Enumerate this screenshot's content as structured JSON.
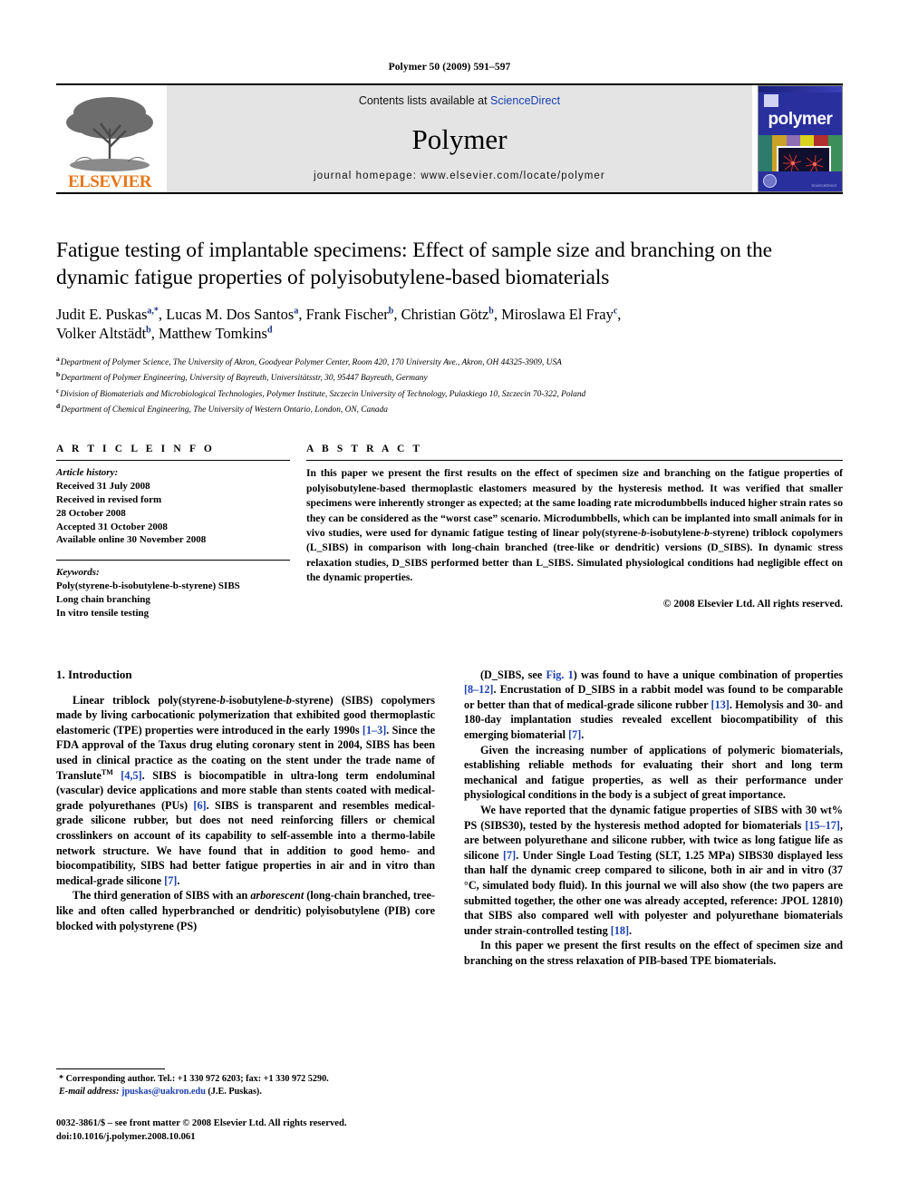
{
  "running_head": "Polymer 50 (2009) 591–597",
  "masthead": {
    "publisher_name": "ELSEVIER",
    "contents_prefix": "Contents lists available at ",
    "contents_link": "ScienceDirect",
    "journal_name": "Polymer",
    "homepage": "journal homepage: www.elsevier.com/locate/polymer",
    "cover_title": "polymer",
    "link_color": "#1a3fb0"
  },
  "article": {
    "title": "Fatigue testing of implantable specimens: Effect of sample size and branching on the dynamic fatigue properties of polyisobutylene-based biomaterials",
    "authors_line1_parts": [
      {
        "name": "Judit E. Puskas",
        "sup": "a,*"
      },
      {
        "name": "Lucas M. Dos Santos",
        "sup": "a"
      },
      {
        "name": "Frank Fischer",
        "sup": "b"
      },
      {
        "name": "Christian Götz",
        "sup": "b"
      },
      {
        "name": "Miroslawa El Fray",
        "sup": "c"
      }
    ],
    "authors_line2_parts": [
      {
        "name": "Volker Altstädt",
        "sup": "b"
      },
      {
        "name": "Matthew Tomkins",
        "sup": "d"
      }
    ],
    "affiliations": [
      {
        "mark": "a",
        "text": "Department of Polymer Science, The University of Akron, Goodyear Polymer Center, Room 420, 170 University Ave., Akron, OH 44325-3909, USA"
      },
      {
        "mark": "b",
        "text": "Department of Polymer Engineering, University of Bayreuth, Universitätsstr, 30, 95447 Bayreuth, Germany"
      },
      {
        "mark": "c",
        "text": "Division of Biomaterials and Microbiological Technologies, Polymer Institute, Szczecin University of Technology, Pulaskiego 10, Szczecin 70-322, Poland"
      },
      {
        "mark": "d",
        "text": "Department of Chemical Engineering, The University of Western Ontario, London, ON, Canada"
      }
    ]
  },
  "article_info": {
    "heading": "A R T I C L E  I N F O",
    "history_label": "Article history:",
    "history_lines": [
      "Received 31 July 2008",
      "Received in revised form",
      "28 October 2008",
      "Accepted 31 October 2008",
      "Available online 30 November 2008"
    ],
    "keywords_label": "Keywords:",
    "keywords": [
      "Poly(styrene-b-isobutylene-b-styrene) SIBS",
      "Long chain branching",
      "In vitro tensile testing"
    ]
  },
  "abstract": {
    "heading": "A B S T R A C T",
    "text": "In this paper we present the first results on the effect of specimen size and branching on the fatigue properties of polyisobutylene-based thermoplastic elastomers measured by the hysteresis method. It was verified that smaller specimens were inherently stronger as expected; at the same loading rate microdumbbells induced higher strain rates so they can be considered as the “worst case” scenario. Microdumbbells, which can be implanted into small animals for in vivo studies, were used for dynamic fatigue testing of linear poly(styrene-b-isobutylene-b-styrene) triblock copolymers (L_SIBS) in comparison with long-chain branched (tree-like or dendritic) versions (D_SIBS). In dynamic stress relaxation studies, D_SIBS performed better than L_SIBS. Simulated physiological conditions had negligible effect on the dynamic properties.",
    "copyright": "© 2008 Elsevier Ltd. All rights reserved."
  },
  "body": {
    "section_number_title": "1. Introduction",
    "left_paragraphs": [
      "Linear triblock poly(styrene-b-isobutylene-b-styrene) (SIBS) copolymers made by living carbocationic polymerization that exhibited good thermoplastic elastomeric (TPE) properties were introduced in the early 1990s [1–3]. Since the FDA approval of the Taxus drug eluting coronary stent in 2004, SIBS has been used in clinical practice as the coating on the stent under the trade name of Translute™ [4,5]. SIBS is biocompatible in ultra-long term endoluminal (vascular) device applications and more stable than stents coated with medical-grade polyurethanes (PUs) [6]. SIBS is transparent and resembles medical-grade silicone rubber, but does not need reinforcing fillers or chemical crosslinkers on account of its capability to self-assemble into a thermo-labile network structure. We have found that in addition to good hemo- and biocompatibility, SIBS had better fatigue properties in air and in vitro than medical-grade silicone [7].",
      "The third generation of SIBS with an arborescent (long-chain branched, tree-like and often called hyperbranched or dendritic) polyisobutylene (PIB) core blocked with polystyrene (PS)"
    ],
    "right_paragraphs": [
      "(D_SIBS, see Fig. 1) was found to have a unique combination of properties [8–12]. Encrustation of D_SIBS in a rabbit model was found to be comparable or better than that of medical-grade silicone rubber [13]. Hemolysis and 30- and 180-day implantation studies revealed excellent biocompatibility of this emerging biomaterial [7].",
      "Given the increasing number of applications of polymeric biomaterials, establishing reliable methods for evaluating their short and long term mechanical and fatigue properties, as well as their performance under physiological conditions in the body is a subject of great importance.",
      "We have reported that the dynamic fatigue properties of SIBS with 30 wt% PS (SIBS30), tested by the hysteresis method adopted for biomaterials [15–17], are between polyurethane and silicone rubber, with twice as long fatigue life as silicone [7]. Under Single Load Testing (SLT, 1.25 MPa) SIBS30 displayed less than half the dynamic creep compared to silicone, both in air and in vitro (37 °C, simulated body fluid). In this journal we will also show (the two papers are submitted together, the other one was already accepted, reference: JPOL 12810) that SIBS also compared well with polyester and polyurethane biomaterials under strain-controlled testing [18].",
      "In this paper we present the first results on the effect of specimen size and branching on the stress relaxation of PIB-based TPE biomaterials."
    ]
  },
  "footnote": {
    "line1": "* Corresponding author. Tel.: +1 330 972 6203; fax: +1 330 972 5290.",
    "email_label": "E-mail address:",
    "email": "jpuskas@uakron.edu",
    "email_suffix": "(J.E. Puskas)."
  },
  "page_footer": {
    "line1": "0032-3861/$ – see front matter © 2008 Elsevier Ltd. All rights reserved.",
    "line2": "doi:10.1016/j.polymer.2008.10.061"
  }
}
